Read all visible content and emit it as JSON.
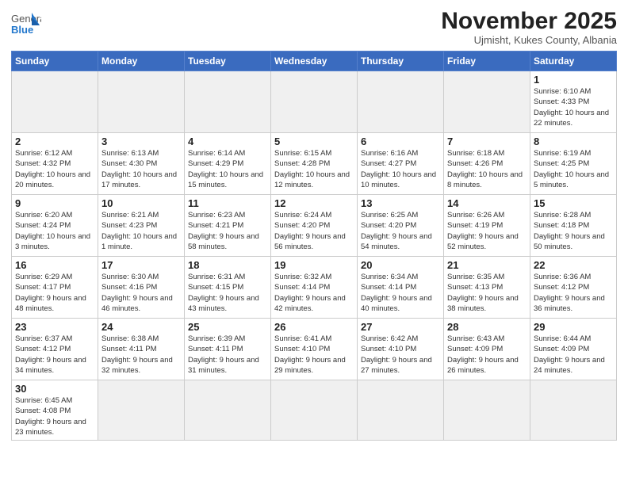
{
  "header": {
    "logo_general": "General",
    "logo_blue": "Blue",
    "month_title": "November 2025",
    "subtitle": "Ujmisht, Kukes County, Albania"
  },
  "weekdays": [
    "Sunday",
    "Monday",
    "Tuesday",
    "Wednesday",
    "Thursday",
    "Friday",
    "Saturday"
  ],
  "weeks": [
    [
      {
        "day": "",
        "info": "",
        "empty": true
      },
      {
        "day": "",
        "info": "",
        "empty": true
      },
      {
        "day": "",
        "info": "",
        "empty": true
      },
      {
        "day": "",
        "info": "",
        "empty": true
      },
      {
        "day": "",
        "info": "",
        "empty": true
      },
      {
        "day": "",
        "info": "",
        "empty": true
      },
      {
        "day": "1",
        "info": "Sunrise: 6:10 AM\nSunset: 4:33 PM\nDaylight: 10 hours and 22 minutes.",
        "empty": false
      }
    ],
    [
      {
        "day": "2",
        "info": "Sunrise: 6:12 AM\nSunset: 4:32 PM\nDaylight: 10 hours and 20 minutes.",
        "empty": false
      },
      {
        "day": "3",
        "info": "Sunrise: 6:13 AM\nSunset: 4:30 PM\nDaylight: 10 hours and 17 minutes.",
        "empty": false
      },
      {
        "day": "4",
        "info": "Sunrise: 6:14 AM\nSunset: 4:29 PM\nDaylight: 10 hours and 15 minutes.",
        "empty": false
      },
      {
        "day": "5",
        "info": "Sunrise: 6:15 AM\nSunset: 4:28 PM\nDaylight: 10 hours and 12 minutes.",
        "empty": false
      },
      {
        "day": "6",
        "info": "Sunrise: 6:16 AM\nSunset: 4:27 PM\nDaylight: 10 hours and 10 minutes.",
        "empty": false
      },
      {
        "day": "7",
        "info": "Sunrise: 6:18 AM\nSunset: 4:26 PM\nDaylight: 10 hours and 8 minutes.",
        "empty": false
      },
      {
        "day": "8",
        "info": "Sunrise: 6:19 AM\nSunset: 4:25 PM\nDaylight: 10 hours and 5 minutes.",
        "empty": false
      }
    ],
    [
      {
        "day": "9",
        "info": "Sunrise: 6:20 AM\nSunset: 4:24 PM\nDaylight: 10 hours and 3 minutes.",
        "empty": false
      },
      {
        "day": "10",
        "info": "Sunrise: 6:21 AM\nSunset: 4:23 PM\nDaylight: 10 hours and 1 minute.",
        "empty": false
      },
      {
        "day": "11",
        "info": "Sunrise: 6:23 AM\nSunset: 4:21 PM\nDaylight: 9 hours and 58 minutes.",
        "empty": false
      },
      {
        "day": "12",
        "info": "Sunrise: 6:24 AM\nSunset: 4:20 PM\nDaylight: 9 hours and 56 minutes.",
        "empty": false
      },
      {
        "day": "13",
        "info": "Sunrise: 6:25 AM\nSunset: 4:20 PM\nDaylight: 9 hours and 54 minutes.",
        "empty": false
      },
      {
        "day": "14",
        "info": "Sunrise: 6:26 AM\nSunset: 4:19 PM\nDaylight: 9 hours and 52 minutes.",
        "empty": false
      },
      {
        "day": "15",
        "info": "Sunrise: 6:28 AM\nSunset: 4:18 PM\nDaylight: 9 hours and 50 minutes.",
        "empty": false
      }
    ],
    [
      {
        "day": "16",
        "info": "Sunrise: 6:29 AM\nSunset: 4:17 PM\nDaylight: 9 hours and 48 minutes.",
        "empty": false
      },
      {
        "day": "17",
        "info": "Sunrise: 6:30 AM\nSunset: 4:16 PM\nDaylight: 9 hours and 46 minutes.",
        "empty": false
      },
      {
        "day": "18",
        "info": "Sunrise: 6:31 AM\nSunset: 4:15 PM\nDaylight: 9 hours and 43 minutes.",
        "empty": false
      },
      {
        "day": "19",
        "info": "Sunrise: 6:32 AM\nSunset: 4:14 PM\nDaylight: 9 hours and 42 minutes.",
        "empty": false
      },
      {
        "day": "20",
        "info": "Sunrise: 6:34 AM\nSunset: 4:14 PM\nDaylight: 9 hours and 40 minutes.",
        "empty": false
      },
      {
        "day": "21",
        "info": "Sunrise: 6:35 AM\nSunset: 4:13 PM\nDaylight: 9 hours and 38 minutes.",
        "empty": false
      },
      {
        "day": "22",
        "info": "Sunrise: 6:36 AM\nSunset: 4:12 PM\nDaylight: 9 hours and 36 minutes.",
        "empty": false
      }
    ],
    [
      {
        "day": "23",
        "info": "Sunrise: 6:37 AM\nSunset: 4:12 PM\nDaylight: 9 hours and 34 minutes.",
        "empty": false
      },
      {
        "day": "24",
        "info": "Sunrise: 6:38 AM\nSunset: 4:11 PM\nDaylight: 9 hours and 32 minutes.",
        "empty": false
      },
      {
        "day": "25",
        "info": "Sunrise: 6:39 AM\nSunset: 4:11 PM\nDaylight: 9 hours and 31 minutes.",
        "empty": false
      },
      {
        "day": "26",
        "info": "Sunrise: 6:41 AM\nSunset: 4:10 PM\nDaylight: 9 hours and 29 minutes.",
        "empty": false
      },
      {
        "day": "27",
        "info": "Sunrise: 6:42 AM\nSunset: 4:10 PM\nDaylight: 9 hours and 27 minutes.",
        "empty": false
      },
      {
        "day": "28",
        "info": "Sunrise: 6:43 AM\nSunset: 4:09 PM\nDaylight: 9 hours and 26 minutes.",
        "empty": false
      },
      {
        "day": "29",
        "info": "Sunrise: 6:44 AM\nSunset: 4:09 PM\nDaylight: 9 hours and 24 minutes.",
        "empty": false
      }
    ],
    [
      {
        "day": "30",
        "info": "Sunrise: 6:45 AM\nSunset: 4:08 PM\nDaylight: 9 hours and 23 minutes.",
        "empty": false
      },
      {
        "day": "",
        "info": "",
        "empty": true
      },
      {
        "day": "",
        "info": "",
        "empty": true
      },
      {
        "day": "",
        "info": "",
        "empty": true
      },
      {
        "day": "",
        "info": "",
        "empty": true
      },
      {
        "day": "",
        "info": "",
        "empty": true
      },
      {
        "day": "",
        "info": "",
        "empty": true
      }
    ]
  ]
}
